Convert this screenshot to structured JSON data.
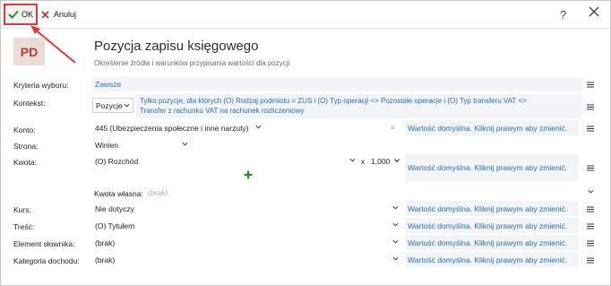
{
  "toolbar": {
    "ok_label": "OK",
    "cancel_label": "Anuluj",
    "help_label": "?"
  },
  "header": {
    "logo_text": "PD",
    "title": "Pozycja zapisu księgowego",
    "subtitle": "Określenie źródła i warunków przypisania wartości dla pozycji"
  },
  "form": {
    "kryteria": {
      "label": "Kryteria wyboru:",
      "value": "Zawsze"
    },
    "kontekst": {
      "label": "Kontekst:",
      "select_value": "Pozycje",
      "condition_line1": "Tylko pozycje, dla których (O) Rodzaj podmiotu = ZUS i (O) Typ operacji <> Pozostałe operacje i (O) Typ transferu VAT <>",
      "condition_line2": "Transfer z rachunku VAT na rachunek rozliczeniowy"
    },
    "konto": {
      "label": "Konto:",
      "value": "445 (Ubezpieczenia społeczne i inne narzuty)",
      "menu_glyph": "≡"
    },
    "strona": {
      "label": "Strona:",
      "value": "Winien"
    },
    "kwota": {
      "label": "Kwota:",
      "value": "(O) Rozchód",
      "multiplier_sign": "x",
      "multiplier": "1,000"
    },
    "kwota_wlasna": {
      "label": "Kwota własna:",
      "placeholder": "(brak)"
    },
    "kurs": {
      "label": "Kurs:",
      "value": "Nie dotyczy"
    },
    "tresc": {
      "label": "Treść:",
      "value": "(O) Tytułem"
    },
    "element_slownika": {
      "label": "Element słownika:",
      "value": "(brak)"
    },
    "kategoria_dochodu": {
      "label": "Kategoria dochodu:",
      "value": "(brak)"
    },
    "default_link": "Wartość domyślna. Kliknij prawym aby zmienić."
  },
  "colors": {
    "accent_blue": "#2a6fb8",
    "ok_green": "#2e8b2e",
    "cancel_red": "#d32f2f",
    "highlight_red": "#e0383c"
  }
}
